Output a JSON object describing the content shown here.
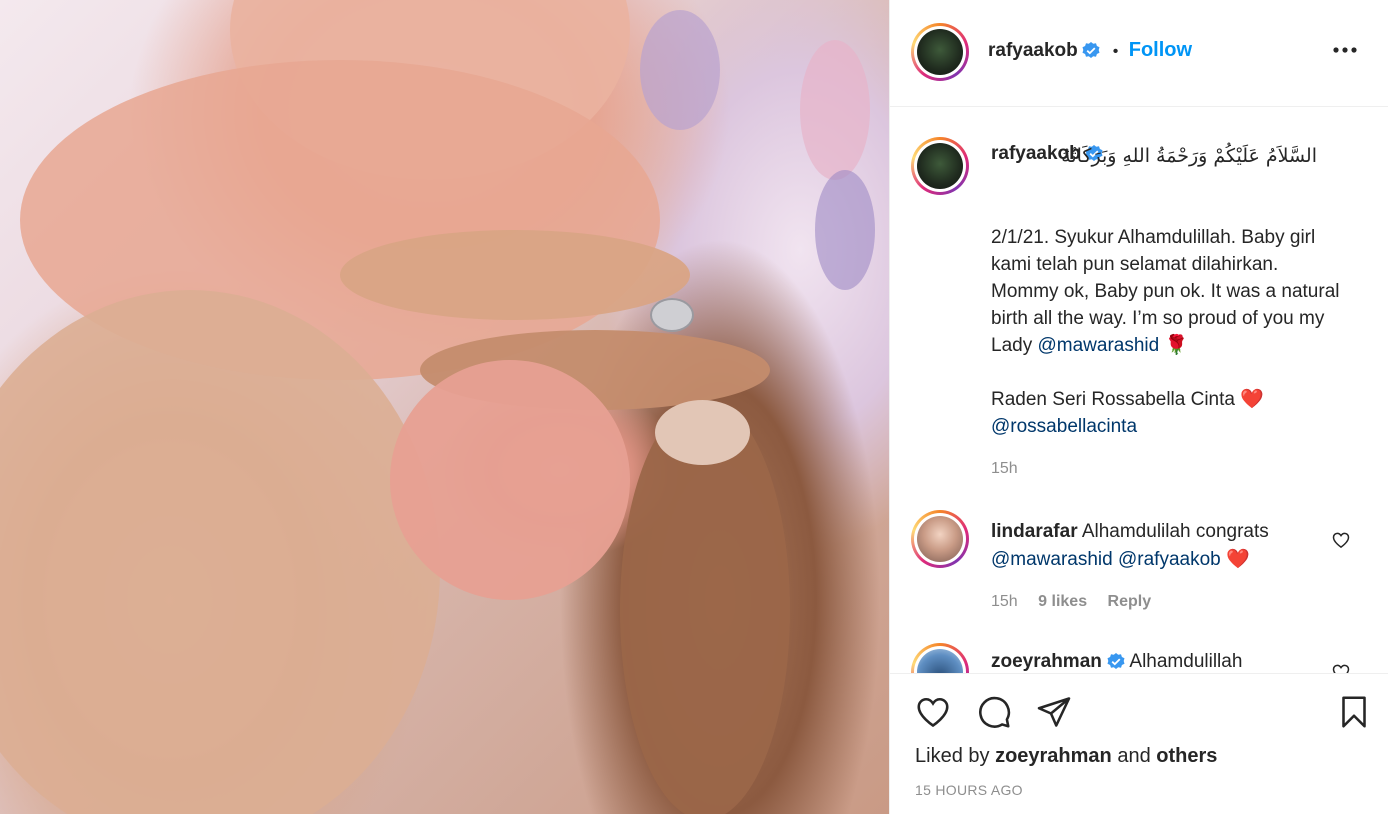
{
  "post": {
    "image_alt": "Newborn baby hand holding adult fingers"
  },
  "header": {
    "username": "rafyaakob",
    "dot": "•",
    "follow_label": "Follow"
  },
  "caption": {
    "username": "rafyaakob",
    "arabic": "السَّلاَمُ عَلَيْكُمْ وَرَحْمَةُ اللهِ وَبَرَكَاتُهُ",
    "line1": "2/1/21. Syukur Alhamdulillah. Baby girl kami telah pun selamat dilahirkan. Mommy ok, Baby pun ok. It was a natural birth all the way. I’m so proud of you my Lady ",
    "mention1": "@mawarashid",
    "emoji1": "🌹",
    "name_line": "Raden Seri Rossabella Cinta ",
    "emoji2": "❤️",
    "mention2": "@rossabellacinta",
    "time": "15h"
  },
  "comments": [
    {
      "username": "lindarafar",
      "text": "Alhamdulilah congrats ",
      "mention1": "@mawarashid",
      "mention2": "@rafyaakob",
      "emoji": "❤️",
      "time": "15h",
      "likes": "9 likes",
      "reply": "Reply"
    },
    {
      "username": "zoeyrahman",
      "text": "Alhamdulillah"
    }
  ],
  "footer": {
    "liked_prefix": "Liked by ",
    "liked_user": "zoeyrahman",
    "liked_and": " and ",
    "liked_others": "others",
    "timestamp": "15 HOURS AGO"
  },
  "icons": {
    "like": "heart-icon",
    "comment": "comment-icon",
    "share": "share-icon",
    "save": "bookmark-icon",
    "more": "more-icon",
    "verified": "verified-badge-icon"
  },
  "colors": {
    "follow": "#0095f6",
    "mention": "#00376b",
    "verified": "#3897f0",
    "muted": "#8e8e8e"
  }
}
